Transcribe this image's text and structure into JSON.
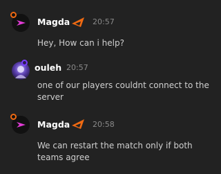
{
  "messages": [
    {
      "author": "Magda",
      "time": "20:57",
      "text": "Hey, How can i help?",
      "avatar_icon": "staff-avatar-icon",
      "status_color": "#f06a12",
      "has_brand_icon": true
    },
    {
      "author": "ouleh",
      "time": "20:57",
      "text": "one of our players couldnt connect to the server",
      "avatar_icon": "player-avatar-icon",
      "status_color": "#7a3cff",
      "has_brand_icon": false
    },
    {
      "author": "Magda",
      "time": "20:58",
      "text": "We can restart the match only if both teams agree",
      "avatar_icon": "staff-avatar-icon",
      "status_color": "#f06a12",
      "has_brand_icon": true
    }
  ],
  "colors": {
    "background": "#222222",
    "brand_orange": "#f06a12",
    "brand_magenta": "#e23bd6"
  }
}
